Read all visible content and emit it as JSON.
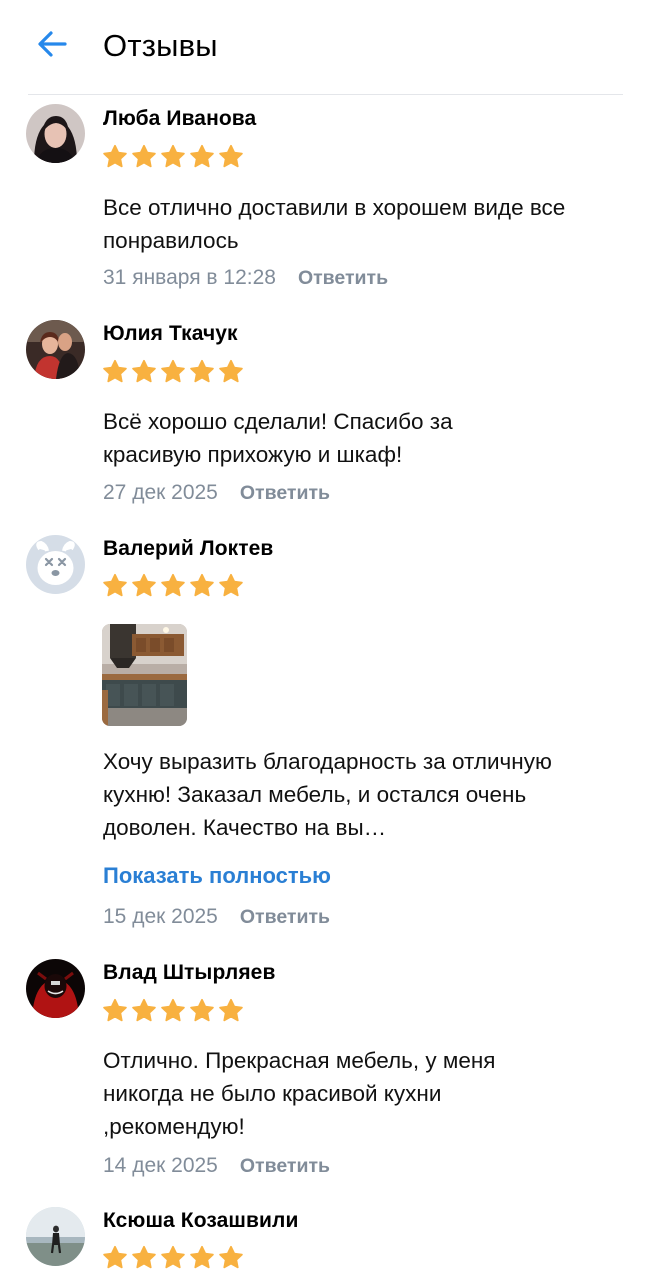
{
  "header": {
    "title": "Отзывы",
    "back_icon": "arrow-left-icon",
    "accent_color": "#2688eb"
  },
  "colors": {
    "star": "#f8b140",
    "link": "#2a7fd4",
    "secondary_text": "#818c99"
  },
  "reviews": [
    {
      "author": "Люба Иванова",
      "rating": 5,
      "text": "Все отлично доставили в хорошем виде все понравилось",
      "date": "31 января в 12:28",
      "reply_label": "Ответить"
    },
    {
      "author": "Юлия Ткачук",
      "rating": 5,
      "text": "Всё хорошо сделали! Спасибо за красивую прихожую и шкаф!",
      "date": "27 дек 2025",
      "reply_label": "Ответить"
    },
    {
      "author": "Валерий Локтев",
      "rating": 5,
      "text": "Хочу выразить благодарность за отличную кухню! Заказал мебель, и остался очень доволен. Качество на вы…",
      "show_more_label": "Показать полностью",
      "date": "15 дек 2025",
      "reply_label": "Ответить"
    },
    {
      "author": "Влад Штырляев",
      "rating": 5,
      "text": "Отлично. Прекрасная  мебель, у меня никогда не было  красивой кухни ,рекомендую!",
      "date": "14 дек 2025",
      "reply_label": "Ответить"
    },
    {
      "author": "Ксюша Козашвили",
      "rating": 5
    }
  ]
}
